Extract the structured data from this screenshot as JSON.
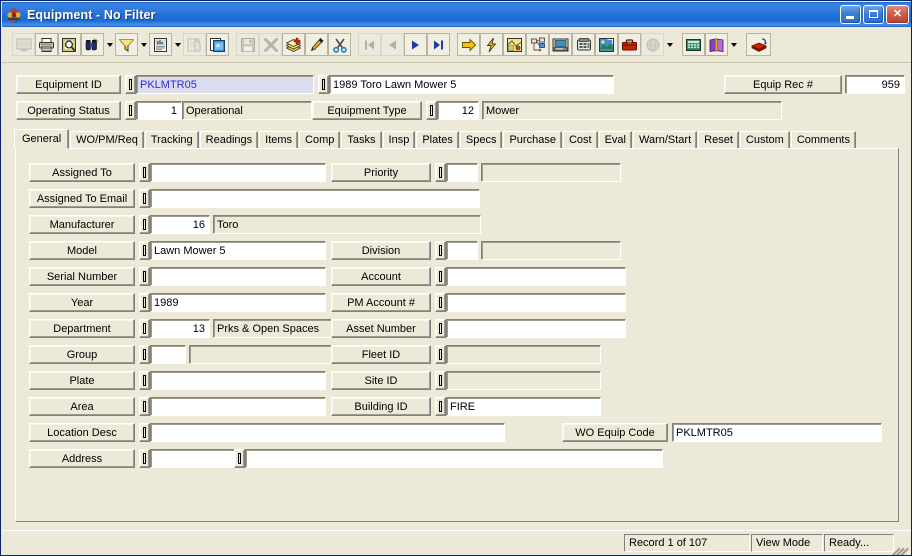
{
  "window": {
    "title": "Equipment - No Filter",
    "app_icon": "equipment-icon",
    "minimize_label": "Minimize",
    "maximize_label": "Maximize",
    "close_label": "Close"
  },
  "toolbar": {
    "groups": [
      {
        "buttons": [
          {
            "icon": "screen-icon",
            "name": "screen-button",
            "disabled": true,
            "dropdown": false,
            "framed": true
          },
          {
            "icon": "printer-icon",
            "name": "print-button",
            "disabled": false,
            "dropdown": false,
            "framed": true
          },
          {
            "icon": "print-preview-icon",
            "name": "print-preview-button",
            "disabled": false,
            "dropdown": false,
            "framed": true
          },
          {
            "icon": "binoculars-find-icon",
            "name": "find-button",
            "disabled": false,
            "dropdown": true,
            "framed": true
          },
          {
            "icon": "funnel-filter-icon",
            "name": "filter-button",
            "disabled": false,
            "dropdown": true,
            "framed": true
          },
          {
            "icon": "report-icon",
            "name": "report-button",
            "disabled": false,
            "dropdown": true,
            "framed": true
          },
          {
            "icon": "properties-icon",
            "name": "properties-button",
            "disabled": true,
            "dropdown": false,
            "framed": true
          },
          {
            "icon": "copy-record-icon",
            "name": "copy-record-button",
            "disabled": false,
            "dropdown": false,
            "framed": true
          }
        ]
      },
      {
        "buttons": [
          {
            "icon": "save-disk-icon",
            "name": "save-button",
            "disabled": true,
            "dropdown": false,
            "framed": true
          },
          {
            "icon": "delete-x-icon",
            "name": "delete-button",
            "disabled": true,
            "dropdown": false,
            "framed": true
          },
          {
            "icon": "add-record-icon",
            "name": "add-record-button",
            "disabled": false,
            "dropdown": false,
            "framed": true
          },
          {
            "icon": "edit-pencil-icon",
            "name": "edit-button",
            "disabled": false,
            "dropdown": false,
            "framed": true
          },
          {
            "icon": "cut-scissors-icon",
            "name": "cut-button",
            "disabled": false,
            "dropdown": false,
            "framed": true
          }
        ]
      },
      {
        "buttons": [
          {
            "icon": "first-record-icon",
            "name": "first-record-button",
            "disabled": true,
            "dropdown": false,
            "framed": true
          },
          {
            "icon": "previous-record-icon",
            "name": "previous-record-button",
            "disabled": true,
            "dropdown": false,
            "framed": true
          },
          {
            "icon": "next-record-icon",
            "name": "next-record-button",
            "disabled": false,
            "dropdown": false,
            "framed": true
          },
          {
            "icon": "last-record-icon",
            "name": "last-record-button",
            "disabled": false,
            "dropdown": false,
            "framed": true
          }
        ]
      },
      {
        "buttons": [
          {
            "icon": "yellow-arrow-goto-icon",
            "name": "goto-button",
            "disabled": false,
            "dropdown": false,
            "framed": true
          },
          {
            "icon": "lightning-action-icon",
            "name": "quick-action-button",
            "disabled": false,
            "dropdown": false,
            "framed": true
          },
          {
            "icon": "map-gis-icon",
            "name": "gis-map-button",
            "disabled": false,
            "dropdown": false,
            "framed": true
          },
          {
            "icon": "hierarchy-tree-icon",
            "name": "hierarchy-button",
            "disabled": false,
            "dropdown": false,
            "framed": true
          },
          {
            "icon": "workstation-icon",
            "name": "workstation-button",
            "disabled": false,
            "dropdown": false,
            "framed": true
          },
          {
            "icon": "telephone-icon",
            "name": "telephone-button",
            "disabled": false,
            "dropdown": false,
            "framed": true
          },
          {
            "icon": "image-picture-icon",
            "name": "picture-button",
            "disabled": false,
            "dropdown": false,
            "framed": true
          },
          {
            "icon": "toolbox-icon",
            "name": "toolbox-button",
            "disabled": false,
            "dropdown": false,
            "framed": true
          },
          {
            "icon": "globe-icon",
            "name": "web-button",
            "disabled": true,
            "dropdown": true,
            "framed": true
          }
        ]
      },
      {
        "buttons": [
          {
            "icon": "calculator-icon",
            "name": "calculator-button",
            "disabled": false,
            "dropdown": false,
            "framed": true
          },
          {
            "icon": "book-help-icon",
            "name": "help-book-button",
            "disabled": false,
            "dropdown": true,
            "framed": true
          }
        ]
      },
      {
        "buttons": [
          {
            "icon": "red-book-exit-icon",
            "name": "exit-book-button",
            "disabled": false,
            "dropdown": false,
            "framed": true
          }
        ]
      }
    ]
  },
  "header": {
    "equipment_id": {
      "label": "Equipment ID",
      "value": "PKLMTR05",
      "gadget": "lookup-gadget"
    },
    "description": {
      "value": "1989 Toro Lawn Mower 5",
      "gadget": "lookup-gadget"
    },
    "equip_rec": {
      "label": "Equip Rec #",
      "value": "959"
    },
    "operating_status": {
      "label": "Operating Status",
      "code": "1",
      "description": "Operational",
      "gadget": "lookup-gadget"
    },
    "equipment_type": {
      "label": "Equipment Type",
      "code": "12",
      "description": "Mower",
      "gadget": "lookup-gadget"
    }
  },
  "tabs": [
    {
      "label": "General",
      "active": true
    },
    {
      "label": "WO/PM/Req",
      "active": false
    },
    {
      "label": "Tracking",
      "active": false
    },
    {
      "label": "Readings",
      "active": false
    },
    {
      "label": "Items",
      "active": false
    },
    {
      "label": "Comp",
      "active": false
    },
    {
      "label": "Tasks",
      "active": false
    },
    {
      "label": "Insp",
      "active": false
    },
    {
      "label": "Plates",
      "active": false
    },
    {
      "label": "Specs",
      "active": false
    },
    {
      "label": "Purchase",
      "active": false
    },
    {
      "label": "Cost",
      "active": false
    },
    {
      "label": "Eval",
      "active": false
    },
    {
      "label": "Warn/Start",
      "active": false
    },
    {
      "label": "Reset",
      "active": false
    },
    {
      "label": "Custom",
      "active": false
    },
    {
      "label": "Comments",
      "active": false
    }
  ],
  "general_tab": {
    "left_fields": [
      {
        "label": "Assigned To",
        "code": "",
        "value": "",
        "has_code_box": false,
        "value_readonly": false
      },
      {
        "label": "Assigned To Email",
        "code": "",
        "value": "",
        "has_code_box": false,
        "value_readonly": false
      },
      {
        "label": "Manufacturer",
        "code": "16",
        "value": "Toro",
        "has_code_box": true,
        "value_readonly": true
      },
      {
        "label": "Model",
        "code": "",
        "value": "Lawn Mower 5",
        "has_code_box": false,
        "value_readonly": false
      },
      {
        "label": "Serial Number",
        "code": "",
        "value": "",
        "has_code_box": false,
        "value_readonly": false
      },
      {
        "label": "Year",
        "code": "",
        "value": "1989",
        "has_code_box": false,
        "value_readonly": false
      },
      {
        "label": "Department",
        "code": "13",
        "value": "Prks & Open Spaces",
        "has_code_box": true,
        "value_readonly": true
      },
      {
        "label": "Group",
        "code": "",
        "value": "",
        "has_code_box": true,
        "value_readonly": true
      },
      {
        "label": "Plate",
        "code": "",
        "value": "",
        "has_code_box": false,
        "value_readonly": false
      },
      {
        "label": "Area",
        "code": "",
        "value": "",
        "has_code_box": false,
        "value_readonly": false
      },
      {
        "label": "Location Desc",
        "code": "",
        "value": "",
        "has_code_box": false,
        "value_readonly": false
      },
      {
        "label": "Address",
        "code": "",
        "value": "",
        "has_code_box": false,
        "value_readonly": false
      }
    ],
    "right_fields": [
      {
        "label": "Priority",
        "code": "",
        "value": "",
        "has_code_box": true,
        "value_readonly": true
      },
      {
        "label": "Division",
        "code": "",
        "value": "",
        "has_code_box": true,
        "value_readonly": true
      },
      {
        "label": "Account",
        "code": "",
        "value": "",
        "has_code_box": false,
        "value_readonly": false
      },
      {
        "label": "PM Account #",
        "code": "",
        "value": "",
        "has_code_box": false,
        "value_readonly": false
      },
      {
        "label": "Asset Number",
        "code": "",
        "value": "",
        "has_code_box": false,
        "value_readonly": false
      },
      {
        "label": "Fleet ID",
        "code": "",
        "value": "",
        "has_code_box": false,
        "value_readonly": true
      },
      {
        "label": "Site ID",
        "code": "",
        "value": "",
        "has_code_box": false,
        "value_readonly": true
      },
      {
        "label": "Building ID",
        "code": "",
        "value": "FIRE",
        "has_code_box": false,
        "value_readonly": false
      }
    ],
    "wo_equip_code": {
      "label": "WO Equip Code",
      "value": "PKLMTR05"
    },
    "address_second": {
      "value": "",
      "gadget": "lookup-gadget"
    }
  },
  "statusbar": {
    "record": "Record 1 of 107",
    "mode": "View Mode",
    "state": "Ready...",
    "grip": "resize-grip"
  }
}
